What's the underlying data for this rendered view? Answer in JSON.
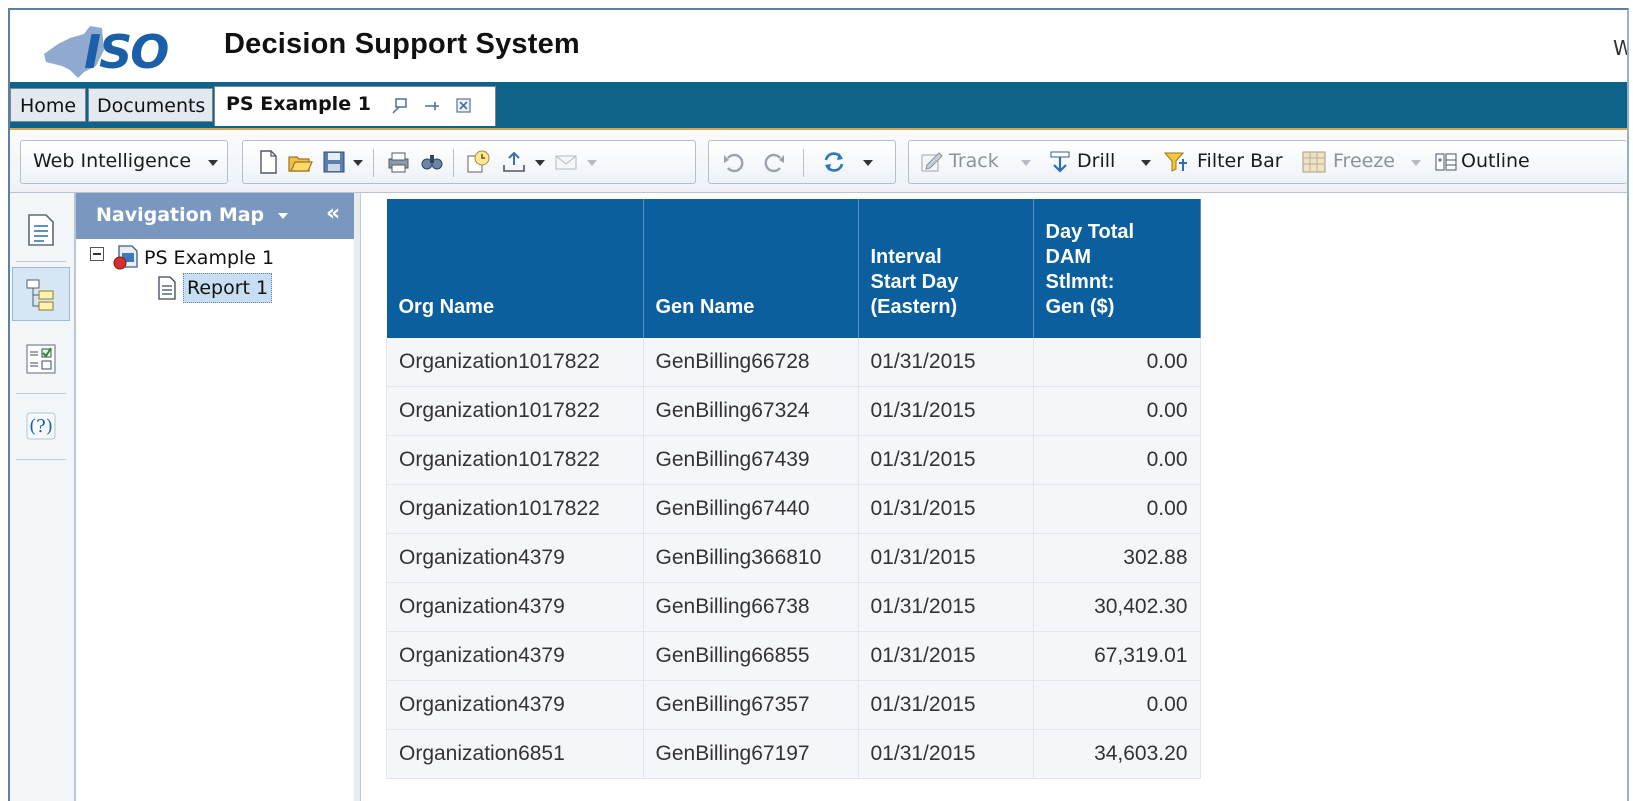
{
  "header": {
    "title": "Decision Support System",
    "user_text": "W"
  },
  "tabs": {
    "home": "Home",
    "documents": "Documents",
    "active": "PS Example 1"
  },
  "toolbar": {
    "app_menu": "Web Intelligence",
    "track": "Track",
    "drill": "Drill",
    "filter_bar": "Filter Bar",
    "freeze": "Freeze",
    "outline": "Outline"
  },
  "nav": {
    "title": "Navigation Map",
    "document": "PS Example 1",
    "report": "Report 1"
  },
  "table": {
    "columns": [
      "Org Name",
      "Gen Name",
      "Interval\nStart Day\n(Eastern)",
      "Day Total\nDAM\nStlmnt:\nGen ($)"
    ],
    "rows": [
      [
        "Organization1017822",
        "GenBilling66728",
        "01/31/2015",
        "0.00"
      ],
      [
        "Organization1017822",
        "GenBilling67324",
        "01/31/2015",
        "0.00"
      ],
      [
        "Organization1017822",
        "GenBilling67439",
        "01/31/2015",
        "0.00"
      ],
      [
        "Organization1017822",
        "GenBilling67440",
        "01/31/2015",
        "0.00"
      ],
      [
        "Organization4379",
        "GenBilling366810",
        "01/31/2015",
        "302.88"
      ],
      [
        "Organization4379",
        "GenBilling66738",
        "01/31/2015",
        "30,402.30"
      ],
      [
        "Organization4379",
        "GenBilling66855",
        "01/31/2015",
        "67,319.01"
      ],
      [
        "Organization4379",
        "GenBilling67357",
        "01/31/2015",
        "0.00"
      ],
      [
        "Organization6851",
        "GenBilling67197",
        "01/31/2015",
        "34,603.20"
      ]
    ]
  },
  "colors": {
    "tabbar_bg": "#0f6388",
    "table_header_bg": "#0b5f9e",
    "nav_header_bg": "#7a98bf",
    "logo_blue": "#1a5fa8"
  },
  "icons": [
    "nyiso-logo",
    "maximize-tab-icon",
    "pin-tab-icon",
    "close-tab-icon",
    "new-document-icon",
    "open-folder-icon",
    "save-icon",
    "print-icon",
    "find-icon",
    "schedule-icon",
    "export-icon",
    "email-icon",
    "undo-icon",
    "redo-icon",
    "refresh-icon",
    "track-icon",
    "drill-icon",
    "filter-bar-icon",
    "freeze-icon",
    "outline-icon",
    "document-summary-icon",
    "navigation-map-icon",
    "input-controls-icon",
    "help-icon"
  ]
}
